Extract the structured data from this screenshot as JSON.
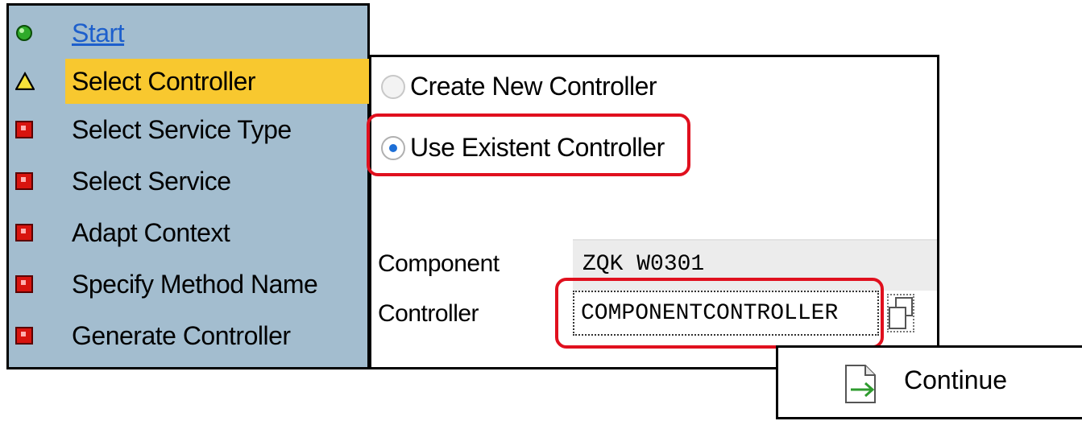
{
  "wizard": {
    "steps": [
      {
        "label": "Start",
        "state": "done",
        "icon": "green-light-icon"
      },
      {
        "label": "Select Controller",
        "state": "current",
        "icon": "warning-triangle-icon"
      },
      {
        "label": "Select Service Type",
        "state": "pending",
        "icon": "red-stop-icon"
      },
      {
        "label": "Select Service",
        "state": "pending",
        "icon": "red-stop-icon"
      },
      {
        "label": "Adapt Context",
        "state": "pending",
        "icon": "red-stop-icon"
      },
      {
        "label": "Specify Method Name",
        "state": "pending",
        "icon": "red-stop-icon"
      },
      {
        "label": "Generate Controller",
        "state": "pending",
        "icon": "red-stop-icon"
      }
    ]
  },
  "panel": {
    "radio_create": "Create New Controller",
    "radio_use": "Use Existent Controller",
    "selected_option": "Use Existent Controller",
    "component_label": "Component",
    "component_value": "ZQK W0301",
    "controller_label": "Controller",
    "controller_value": "COMPONENTCONTROLLER"
  },
  "actions": {
    "continue_label": "Continue"
  },
  "colors": {
    "step_bg": "#a3bdcf",
    "highlight": "#f8c82f",
    "annotation_red": "#e0101e",
    "link_blue": "#1d5fcc"
  }
}
